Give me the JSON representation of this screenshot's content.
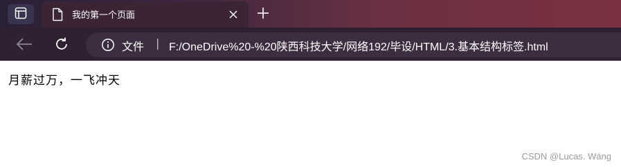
{
  "tab": {
    "title": "我的第一个页面"
  },
  "addressbar": {
    "label": "文件",
    "separator": "|",
    "url": "F:/OneDrive%20-%20陕西科技大学/网络192/毕设/HTML/3.基本结构标签.html"
  },
  "page": {
    "text": "月薪过万，一飞冲天"
  },
  "watermark": "CSDN @Lucas. Wáng",
  "icons": {
    "tab_actions": "tab-actions-icon",
    "page": "page-icon",
    "close": "close-icon",
    "new_tab": "plus-icon",
    "back": "back-arrow-icon",
    "reload": "reload-icon",
    "info": "info-icon"
  },
  "colors": {
    "tabbar_start": "#2a2036",
    "tabbar_end": "#7b3140",
    "toolbar": "#2f2033",
    "address_bg": "#3d2d41"
  }
}
